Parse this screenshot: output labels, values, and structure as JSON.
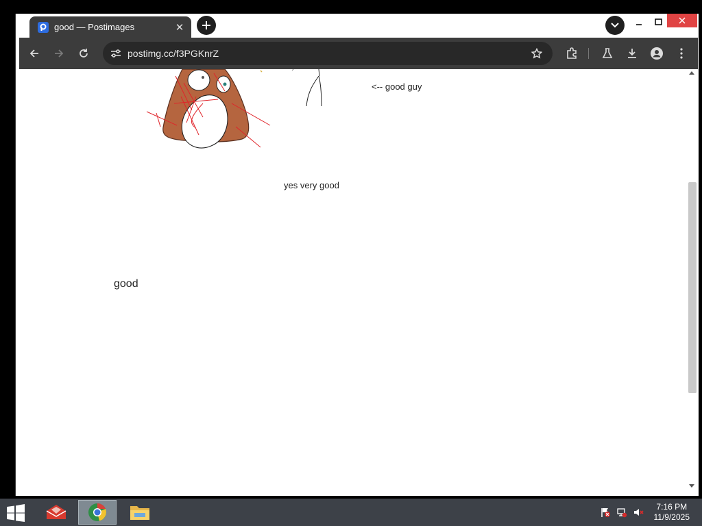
{
  "browser": {
    "tab": {
      "title": "good — Postimages",
      "favicon": "postimages-icon"
    },
    "address_bar": {
      "url": "postimg.cc/f3PGKnrZ"
    }
  },
  "content": {
    "annotation_good_guy": "<-- good guy",
    "caption_yes_very_good": "yes very good",
    "caption_good": "good"
  },
  "taskbar": {
    "time": "7:16 PM",
    "date": "11/9/2025",
    "apps": [
      "app-icon",
      "chrome-icon",
      "file-explorer-icon"
    ]
  },
  "colors": {
    "tab_bg": "#3c3c3c",
    "toolbar_bg": "#3c3c3c",
    "omnibox_bg": "#282828",
    "close_red": "#e04343",
    "drawing_brown": "#b5653f",
    "drawing_red": "#e0242a",
    "taskbar_bg": "#3d4148"
  }
}
